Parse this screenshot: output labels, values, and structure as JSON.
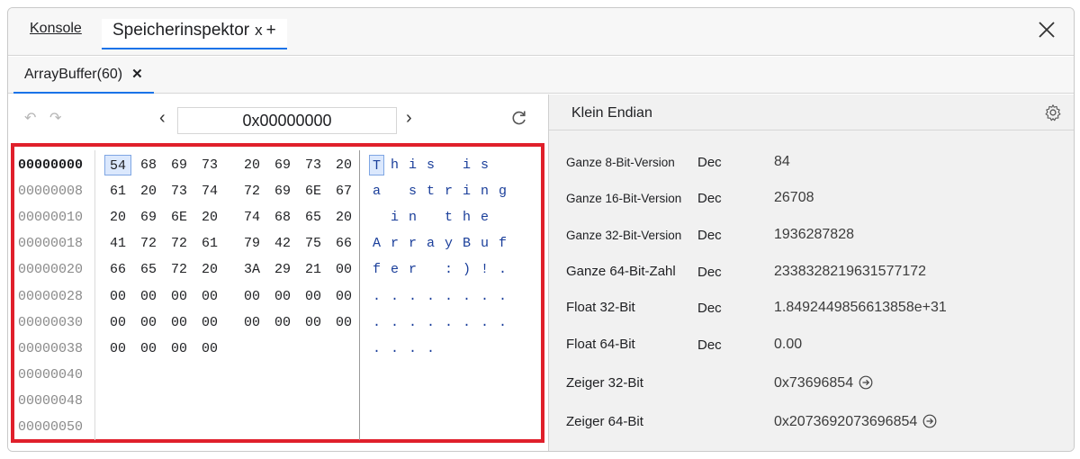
{
  "tabs": {
    "console": "Konsole",
    "memory": "Speicherinspektor",
    "memory_close": "x",
    "add": "+"
  },
  "buffer_tab": {
    "label": "ArrayBuffer(60)",
    "close": "✕"
  },
  "nav": {
    "address": "0x00000000",
    "prev": "‹",
    "next": "›",
    "undo": "↶",
    "redo": "↷"
  },
  "hex_rows": [
    {
      "addr": "00000000",
      "bytes": [
        "54",
        "68",
        "69",
        "73",
        "20",
        "69",
        "73",
        "20"
      ],
      "chars": [
        "T",
        "h",
        "i",
        "s",
        " ",
        "i",
        "s",
        " "
      ]
    },
    {
      "addr": "00000008",
      "bytes": [
        "61",
        "20",
        "73",
        "74",
        "72",
        "69",
        "6E",
        "67"
      ],
      "chars": [
        "a",
        " ",
        "s",
        "t",
        "r",
        "i",
        "n",
        "g"
      ]
    },
    {
      "addr": "00000010",
      "bytes": [
        "20",
        "69",
        "6E",
        "20",
        "74",
        "68",
        "65",
        "20"
      ],
      "chars": [
        " ",
        "i",
        "n",
        " ",
        "t",
        "h",
        "e",
        " "
      ]
    },
    {
      "addr": "00000018",
      "bytes": [
        "41",
        "72",
        "72",
        "61",
        "79",
        "42",
        "75",
        "66"
      ],
      "chars": [
        "A",
        "r",
        "r",
        "a",
        "y",
        "B",
        "u",
        "f"
      ]
    },
    {
      "addr": "00000020",
      "bytes": [
        "66",
        "65",
        "72",
        "20",
        "3A",
        "29",
        "21",
        "00"
      ],
      "chars": [
        "f",
        "e",
        "r",
        " ",
        ":",
        ")",
        "!",
        "."
      ]
    },
    {
      "addr": "00000028",
      "bytes": [
        "00",
        "00",
        "00",
        "00",
        "00",
        "00",
        "00",
        "00"
      ],
      "chars": [
        ".",
        ".",
        ".",
        ".",
        ".",
        ".",
        ".",
        "."
      ]
    },
    {
      "addr": "00000030",
      "bytes": [
        "00",
        "00",
        "00",
        "00",
        "00",
        "00",
        "00",
        "00"
      ],
      "chars": [
        ".",
        ".",
        ".",
        ".",
        ".",
        ".",
        ".",
        "."
      ]
    },
    {
      "addr": "00000038",
      "bytes": [
        "00",
        "00",
        "00",
        "00"
      ],
      "chars": [
        ".",
        ".",
        ".",
        "."
      ]
    },
    {
      "addr": "00000040",
      "bytes": [],
      "chars": []
    },
    {
      "addr": "00000048",
      "bytes": [],
      "chars": []
    },
    {
      "addr": "00000050",
      "bytes": [],
      "chars": []
    }
  ],
  "endianness": "Klein  Endian",
  "values": [
    {
      "name": "Ganze 8-Bit-Version",
      "mode": "Dec",
      "value": "84",
      "small": true,
      "jump": false
    },
    {
      "name": "Ganze 16-Bit-Version",
      "mode": "Dec",
      "value": "26708",
      "small": true,
      "jump": false
    },
    {
      "name": "Ganze 32-Bit-Version",
      "mode": "Dec",
      "value": "1936287828",
      "small": true,
      "jump": false
    },
    {
      "name": "Ganze 64-Bit-Zahl",
      "mode": "Dec",
      "value": "2338328219631577172",
      "small": false,
      "jump": false
    },
    {
      "name": "Float 32-Bit",
      "mode": "Dec",
      "value": "1.8492449856613858e+31",
      "small": false,
      "jump": false
    },
    {
      "name": "Float 64-Bit",
      "mode": "Dec",
      "value": "0.00",
      "small": false,
      "jump": false
    },
    {
      "name": "Zeiger 32-Bit",
      "mode": "",
      "value": "0x73696854",
      "small": false,
      "jump": true
    },
    {
      "name": "Zeiger 64-Bit",
      "mode": "",
      "value": "0x2073692073696854",
      "small": false,
      "jump": true
    }
  ],
  "colors": {
    "accent": "#1a73e8",
    "highlight_border": "#e0202b",
    "ascii_text": "#1a3e9a",
    "selected_bg": "#dbe8fd"
  }
}
